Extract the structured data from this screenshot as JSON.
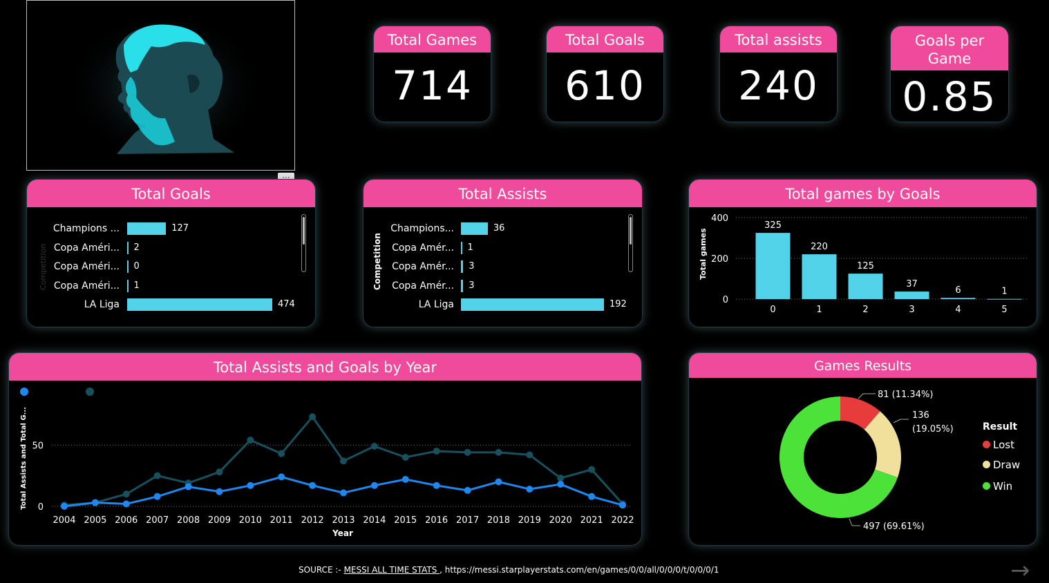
{
  "kpis": [
    {
      "label": "Total Games",
      "value": "714"
    },
    {
      "label": "Total Goals",
      "value": "610"
    },
    {
      "label": "Total assists",
      "value": "240"
    },
    {
      "label": "Goals per Game",
      "value": "0.85"
    }
  ],
  "logo": {
    "icon": "player-portrait-logo",
    "more_label": "···"
  },
  "colors": {
    "accent": "#ef4a9b",
    "bar": "#53d3ea",
    "goals_line": "#18505e",
    "assists_line": "#1e88f0",
    "lost": "#e83b3b",
    "draw": "#f0e09c",
    "win": "#4de23a"
  },
  "goals_by_competition": {
    "title": "Total Goals",
    "axis_title": "Competition",
    "rows": [
      {
        "label": "Champions ...",
        "value": 127
      },
      {
        "label": "Copa Améri...",
        "value": 2
      },
      {
        "label": "Copa Améri...",
        "value": 0
      },
      {
        "label": "Copa Améri...",
        "value": 1
      },
      {
        "label": "LA Liga",
        "value": 474
      }
    ]
  },
  "assists_by_competition": {
    "title": "Total Assists",
    "axis_title": "Competition",
    "rows": [
      {
        "label": "Champions...",
        "value": 36
      },
      {
        "label": "Copa Amér...",
        "value": 1
      },
      {
        "label": "Copa Amér...",
        "value": 3
      },
      {
        "label": "Copa Amér...",
        "value": 3
      },
      {
        "label": "LA Liga",
        "value": 192
      }
    ]
  },
  "chart_data": [
    {
      "type": "bar",
      "title": "Total games by Goals",
      "ylabel": "Total games",
      "xlabel": "",
      "categories": [
        "0",
        "1",
        "2",
        "3",
        "4",
        "5"
      ],
      "values": [
        325,
        220,
        125,
        37,
        6,
        1
      ],
      "ylim": [
        0,
        400
      ],
      "yticks": [
        "0",
        "200",
        "400"
      ],
      "grid": true
    },
    {
      "type": "line",
      "title": "Total Assists and Goals by Year",
      "xlabel": "Year",
      "ylabel": "Total Assists and Total G...",
      "x": [
        "2004",
        "2005",
        "2006",
        "2007",
        "2008",
        "2009",
        "2010",
        "2011",
        "2012",
        "2013",
        "2014",
        "2015",
        "2016",
        "2017",
        "2018",
        "2019",
        "2020",
        "2021",
        "2022"
      ],
      "ylim": [
        0,
        80
      ],
      "yticks": [
        "0",
        "50"
      ],
      "grid": true,
      "legend": "top-left",
      "series": [
        {
          "color": "#18505e",
          "values": [
            1,
            3,
            10,
            25,
            19,
            28,
            54,
            43,
            73,
            37,
            49,
            40,
            45,
            44,
            44,
            42,
            23,
            30,
            2
          ]
        },
        {
          "color": "#1e88f0",
          "values": [
            0,
            3,
            2,
            8,
            16,
            12,
            17,
            24,
            17,
            11,
            17,
            22,
            17,
            13,
            20,
            14,
            18,
            8,
            1
          ]
        }
      ]
    },
    {
      "type": "pie",
      "title": "Games Results",
      "legend_title": "Result",
      "legend": "right",
      "slices": [
        {
          "name": "Lost",
          "value": 81,
          "label": "81 (11.34%)",
          "color": "#e83b3b"
        },
        {
          "name": "Draw",
          "value": 136,
          "label_line1": "136",
          "label_line2": "(19.05%)",
          "color": "#f0e09c"
        },
        {
          "name": "Win",
          "value": 497,
          "label": "497 (69.61%)",
          "color": "#4de23a"
        }
      ]
    }
  ],
  "footer": {
    "prefix": "SOURCE :- ",
    "link_text": "MESSI ALL TIME STATS ",
    "url": ", https://messi.starplayerstats.com/en/games/0/0/all/0/0/0/t/0/0/0/1",
    "next_icon": "→"
  }
}
